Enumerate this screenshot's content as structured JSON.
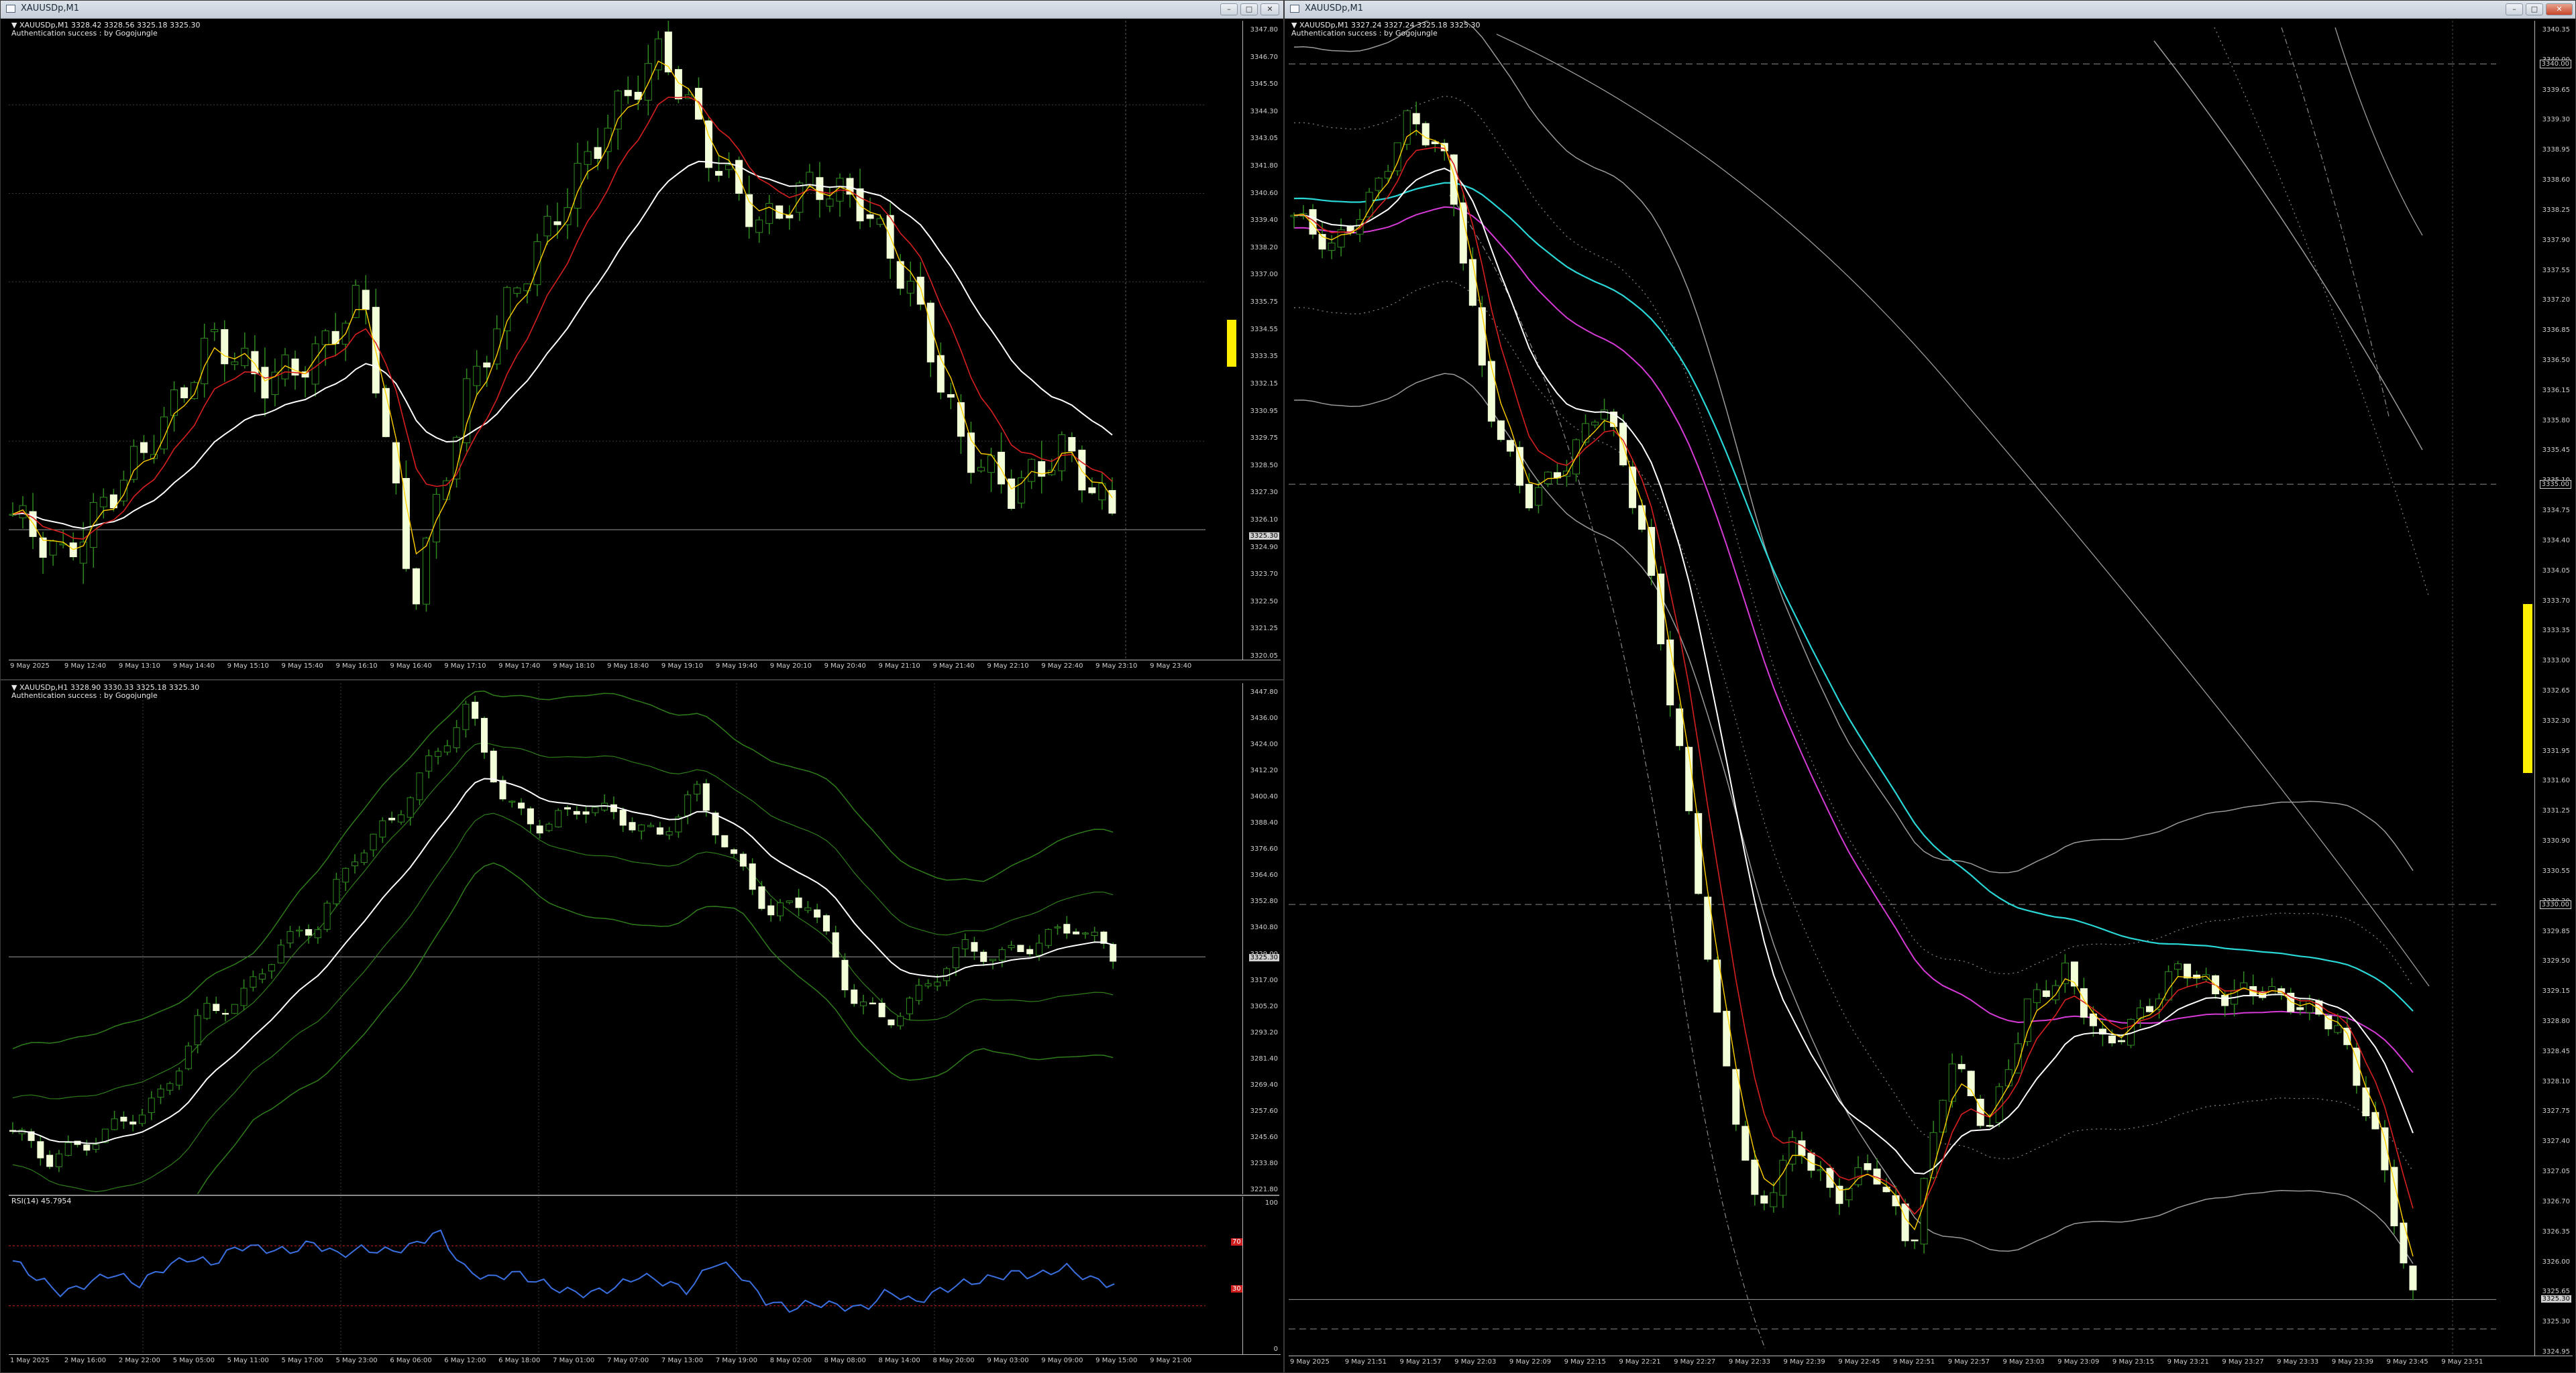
{
  "colors": {
    "background": "#000000",
    "candle_up": "#2f8a1f",
    "candle_down": "#f2ffd9",
    "ma_fast": "#ffd000",
    "ma_mid": "#d81f1f",
    "ma_slow": "#ffffff",
    "ma_cyan": "#29d7d7",
    "ma_magenta": "#d63ad6",
    "bollinger": "#2e7d1a",
    "rsi": "#3a6fe0",
    "rsi_levels": "#d02020",
    "volume_marker": "#ffee00"
  },
  "window_top_left": {
    "title": "XAUUSDp,M1",
    "header_line1": "▼ XAUUSDp,M1  3328.42 3328.56 3325.18 3325.30",
    "header_line2": "Authentication success : by Gogojungle",
    "price_labels": [
      "3347.80",
      "3346.70",
      "3345.50",
      "3344.30",
      "3343.05",
      "3341.80",
      "3340.60",
      "3339.40",
      "3338.20",
      "3337.00",
      "3335.75",
      "3334.55",
      "3333.35",
      "3332.15",
      "3330.95",
      "3329.75",
      "3328.50",
      "3327.30",
      "3326.10",
      "3324.90",
      "3323.70",
      "3322.50",
      "3321.25",
      "3320.05"
    ],
    "price_tag_current": "3325.30",
    "time_labels": [
      "9 May 2025",
      "9 May 12:40",
      "9 May 13:10",
      "9 May 14:40",
      "9 May 15:10",
      "9 May 15:40",
      "9 May 16:10",
      "9 May 16:40",
      "9 May 17:10",
      "9 May 17:40",
      "9 May 18:10",
      "9 May 18:40",
      "9 May 19:10",
      "9 May 19:40",
      "9 May 20:10",
      "9 May 20:40",
      "9 May 21:10",
      "9 May 21:40",
      "9 May 22:10",
      "9 May 22:40",
      "9 May 23:10",
      "9 May 23:40"
    ],
    "buttons": {
      "minimize": "–",
      "maximize": "□",
      "close": "✕"
    }
  },
  "window_bottom_left": {
    "header_line1": "▼ XAUUSDp,H1  3328.90 3330.33 3325.18 3325.30",
    "header_line2": "Authentication success : by Gogojungle",
    "price_labels": [
      "3447.80",
      "3436.00",
      "3424.00",
      "3412.20",
      "3400.40",
      "3388.40",
      "3376.60",
      "3364.60",
      "3352.80",
      "3340.80",
      "3329.00",
      "3317.00",
      "3305.20",
      "3293.20",
      "3281.40",
      "3269.40",
      "3257.60",
      "3245.60",
      "3233.80",
      "3221.80"
    ],
    "price_tag_current": "3325.30",
    "rsi_header": "RSI(14) 45.7954",
    "rsi_labels": [
      "100",
      "0"
    ],
    "rsi_tags": [
      "70",
      "30"
    ],
    "time_labels": [
      "1 May 2025",
      "2 May 16:00",
      "2 May 22:00",
      "5 May 05:00",
      "5 May 11:00",
      "5 May 17:00",
      "5 May 23:00",
      "6 May 06:00",
      "6 May 12:00",
      "6 May 18:00",
      "7 May 01:00",
      "7 May 07:00",
      "7 May 13:00",
      "7 May 19:00",
      "8 May 02:00",
      "8 May 08:00",
      "8 May 14:00",
      "8 May 20:00",
      "9 May 03:00",
      "9 May 09:00",
      "9 May 15:00",
      "9 May 21:00"
    ]
  },
  "window_right": {
    "title": "XAUUSDp,M1",
    "header_line1": "▼ XAUUSDp,M1  3327.24 3327.24 3325.18 3325.30",
    "header_line2": "Authentication success : by Gogojungle",
    "price_labels": [
      "3340.35",
      "3340.00",
      "3339.65",
      "3339.30",
      "3338.95",
      "3338.60",
      "3338.25",
      "3337.90",
      "3337.55",
      "3337.20",
      "3336.85",
      "3336.50",
      "3336.15",
      "3335.80",
      "3335.45",
      "3335.10",
      "3334.75",
      "3334.40",
      "3334.05",
      "3333.70",
      "3333.35",
      "3333.00",
      "3332.65",
      "3332.30",
      "3331.95",
      "3331.60",
      "3331.25",
      "3330.90",
      "3330.55",
      "3330.20",
      "3329.85",
      "3329.50",
      "3329.15",
      "3328.80",
      "3328.45",
      "3328.10",
      "3327.75",
      "3327.40",
      "3327.05",
      "3326.70",
      "3326.35",
      "3326.00",
      "3325.65",
      "3325.30",
      "3324.95"
    ],
    "price_tag_top": "3340.00",
    "price_tag_mid": "3335.00",
    "price_tag_low": "3330.00",
    "price_tag_current": "3325.30",
    "time_labels": [
      "9 May 2025",
      "9 May 21:51",
      "9 May 21:57",
      "9 May 22:03",
      "9 May 22:09",
      "9 May 22:15",
      "9 May 22:21",
      "9 May 22:27",
      "9 May 22:33",
      "9 May 22:39",
      "9 May 22:45",
      "9 May 22:51",
      "9 May 22:57",
      "9 May 23:03",
      "9 May 23:09",
      "9 May 23:15",
      "9 May 23:21",
      "9 May 23:27",
      "9 May 23:33",
      "9 May 23:39",
      "9 May 23:45",
      "9 May 23:51"
    ],
    "buttons": {
      "minimize": "–",
      "maximize": "□",
      "close": "✕"
    }
  }
}
